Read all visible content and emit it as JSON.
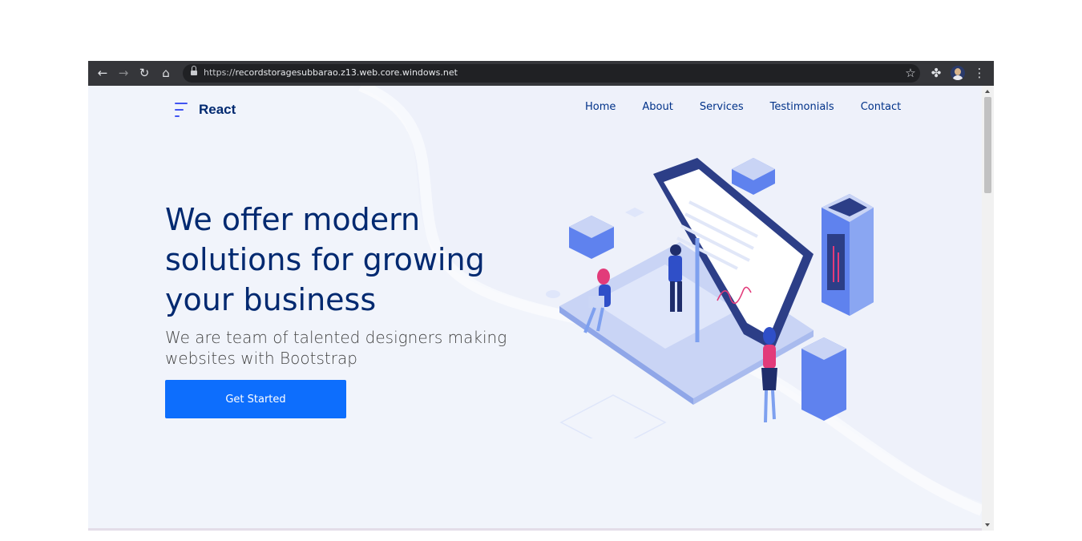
{
  "browser": {
    "url_prefix": "https://",
    "url_host": "recordstoragesubbarao.z13.web.core.windows.net",
    "icons": [
      "back-arrow-icon",
      "forward-arrow-icon",
      "reload-icon",
      "home-icon",
      "lock-icon",
      "star-icon",
      "extensions-icon",
      "profile-avatar",
      "menu-kebab-icon"
    ]
  },
  "site": {
    "logo_text": "React",
    "nav": [
      "Home",
      "About",
      "Services",
      "Testimonials",
      "Contact"
    ]
  },
  "hero": {
    "title": "We offer modern solutions for growing your business",
    "subtitle": "We are team of talented designers making websites with Bootstrap",
    "cta": "Get Started"
  },
  "colors": {
    "brand": "#012970",
    "accent": "#4154f1",
    "button": "#0d6efd",
    "background": "#eef1fa"
  }
}
